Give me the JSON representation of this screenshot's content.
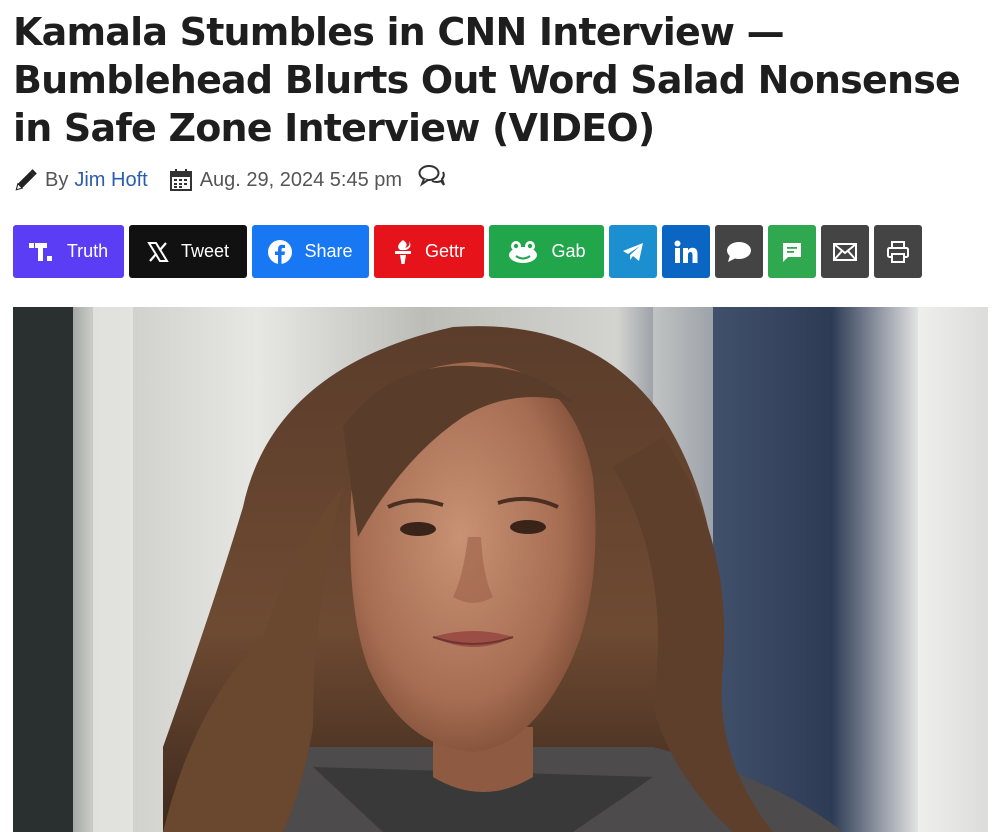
{
  "article": {
    "headline": "Kamala Stumbles in CNN Interview — Bumblehead Blurts Out Word Salad Nonsense in Safe Zone Interview (VIDEO)",
    "byline": {
      "by": "By",
      "author": "Jim Hoft",
      "date": "Aug. 29, 2024 5:45 pm"
    }
  },
  "share_buttons": [
    {
      "label": "Truth",
      "icon": "truth-social-icon",
      "color": "#5b3df5"
    },
    {
      "label": "Tweet",
      "icon": "x-icon",
      "color": "#111111"
    },
    {
      "label": "Share",
      "icon": "facebook-icon",
      "color": "#1877f2"
    },
    {
      "label": "Gettr",
      "icon": "gettr-icon",
      "color": "#e7131a"
    },
    {
      "label": "Gab",
      "icon": "gab-icon",
      "color": "#21a64b"
    },
    {
      "label": "",
      "icon": "telegram-icon",
      "color": "#1c8fd0"
    },
    {
      "label": "",
      "icon": "linkedin-icon",
      "color": "#0a66c2"
    },
    {
      "label": "",
      "icon": "comment-icon",
      "color": "#444444"
    },
    {
      "label": "",
      "icon": "sms-icon",
      "color": "#2fa84f"
    },
    {
      "label": "",
      "icon": "email-icon",
      "color": "#444444"
    },
    {
      "label": "",
      "icon": "print-icon",
      "color": "#444444"
    }
  ],
  "hero_image": {
    "description_icon": "interview-photo"
  }
}
